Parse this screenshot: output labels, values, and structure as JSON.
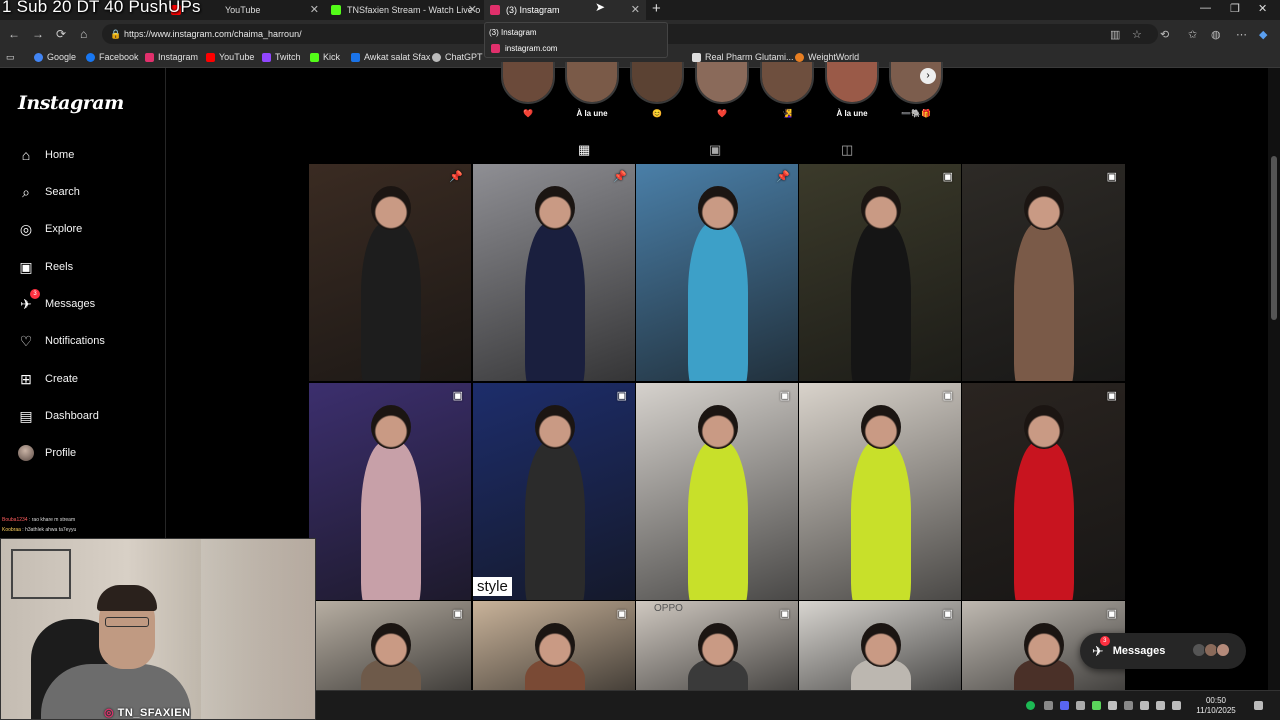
{
  "stream_overlay": {
    "title": "1 Sub 20 DT 40 PushUPs",
    "webcam_label": "TN_SFAXIEN",
    "chat": [
      {
        "user": "Bouba1234",
        "text": "rao khare m stream"
      },
      {
        "user": "Koobraa",
        "text": "h3athlek ahwa ta7eyyu"
      }
    ]
  },
  "browser": {
    "tabs": [
      {
        "label": "YouTube",
        "active": false,
        "favicon_color": "#ff0000"
      },
      {
        "label": "TNSfaxien Stream - Watch Live o",
        "active": false,
        "favicon_color": "#53fc18"
      },
      {
        "label": "(3) Instagram",
        "active": true,
        "favicon_color": "#e1306c"
      }
    ],
    "tooltip": {
      "title": "(3) Instagram",
      "site": "instagram.com"
    },
    "url": "https://www.instagram.com/chaima_harroun/",
    "bookmarks": [
      {
        "label": "Google",
        "color": "#4285f4"
      },
      {
        "label": "Facebook",
        "color": "#1877f2"
      },
      {
        "label": "Instagram",
        "color": "#e1306c"
      },
      {
        "label": "YouTube",
        "color": "#ff0000"
      },
      {
        "label": "Twitch",
        "color": "#9146ff"
      },
      {
        "label": "Kick",
        "color": "#53fc18"
      },
      {
        "label": "Awkat salat Sfax",
        "color": "#1a73e8"
      },
      {
        "label": "ChatGPT",
        "color": "#bbbbbb"
      },
      {
        "label": "Real Pharm Glutami...",
        "color": "#dddddd"
      },
      {
        "label": "WeightWorld",
        "color": "#e67e22"
      }
    ]
  },
  "instagram": {
    "logo": "Instagram",
    "nav": [
      {
        "label": "Home",
        "icon": "home-icon"
      },
      {
        "label": "Search",
        "icon": "search-icon"
      },
      {
        "label": "Explore",
        "icon": "compass-icon"
      },
      {
        "label": "Reels",
        "icon": "reels-icon"
      },
      {
        "label": "Messages",
        "icon": "messenger-icon",
        "badge": "3"
      },
      {
        "label": "Notifications",
        "icon": "heart-icon"
      },
      {
        "label": "Create",
        "icon": "plus-square-icon"
      },
      {
        "label": "Dashboard",
        "icon": "dashboard-icon"
      },
      {
        "label": "Profile",
        "icon": "avatar"
      }
    ],
    "highlights": [
      {
        "label": "❤️",
        "color": "#6b4a3a"
      },
      {
        "label": "À la une",
        "color": "#7a5a48"
      },
      {
        "label": "😊",
        "color": "#5b4233"
      },
      {
        "label": "❤️",
        "color": "#8a6a5a"
      },
      {
        "label": "🧏‍♀️",
        "color": "#6e4f3e"
      },
      {
        "label": "À la une",
        "color": "#9a5a48"
      },
      {
        "label": "➖🐘🎁",
        "color": "#7c5d4d"
      }
    ],
    "profile_tabs": [
      "posts-tab",
      "reels-tab",
      "tagged-tab"
    ],
    "posts": [
      {
        "type": "pinned",
        "bg": "#3a2b22",
        "fig": "#1d1d1d"
      },
      {
        "type": "pinned",
        "bg": "#8f8f94",
        "fig": "#1a1f3e"
      },
      {
        "type": "pinned",
        "bg": "#4a7fa8",
        "fig": "#3da0c8"
      },
      {
        "type": "reel",
        "bg": "#3b3a2a",
        "fig": "#151515"
      },
      {
        "type": "reel",
        "bg": "#2d2a26",
        "fig": "#7a5a48"
      },
      {
        "type": "reel",
        "bg": "#3c2f6e",
        "fig": "#c7a0a8"
      },
      {
        "type": "reel",
        "bg": "#1d2d6b",
        "fig": "#2b2b2b",
        "caption": "style"
      },
      {
        "type": "reel",
        "bg": "#d6d2cd",
        "fig": "#c8e02a"
      },
      {
        "type": "reel",
        "bg": "#d9d3cb",
        "fig": "#c8e02a"
      },
      {
        "type": "reel",
        "bg": "#2a2420",
        "fig": "#c8141f"
      },
      {
        "type": "reel",
        "bg": "#b9b0a4",
        "fig": "#6e5a4a"
      },
      {
        "type": "reel",
        "bg": "#c9b39a",
        "fig": "#7a4a35"
      },
      {
        "type": "reel",
        "bg": "#cfc8c0",
        "fig": "#3a3a3a",
        "caption_top": "OPPO"
      },
      {
        "type": "reel",
        "bg": "#d8d5d0",
        "fig": "#bcb7b0"
      },
      {
        "type": "reel",
        "bg": "#bfb9b1",
        "fig": "#4a3028"
      }
    ],
    "messages_pill": {
      "label": "Messages",
      "badge": "3"
    }
  },
  "taskbar": {
    "time": "00:50",
    "date": "11/10/2025"
  }
}
